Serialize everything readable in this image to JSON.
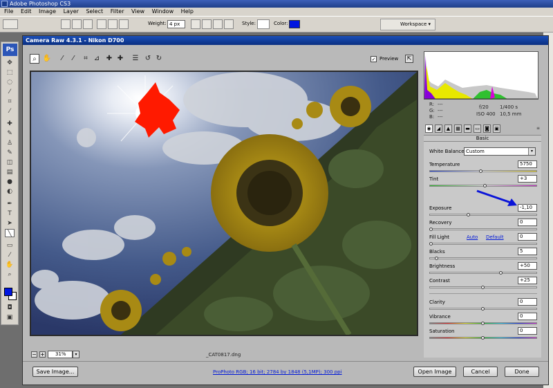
{
  "app": {
    "title": "Adobe Photoshop CS3",
    "menu": [
      "File",
      "Edit",
      "Image",
      "Layer",
      "Select",
      "Filter",
      "View",
      "Window",
      "Help"
    ]
  },
  "options_bar": {
    "weight_label": "Weight:",
    "weight_value": "4 px",
    "style_label": "Style:",
    "color_label": "Color:",
    "color_value": "#0016e0",
    "workspace_label": "Workspace"
  },
  "toolbox": {
    "logo": "Ps",
    "foreground_color": "#0016e0",
    "background_color": "#ffffff"
  },
  "dialog": {
    "title": "Camera Raw 4.3.1  -  Nikon D700",
    "preview_label": "Preview",
    "preview_checked": true,
    "zoom": "31%",
    "filename": "_CAT0817.dng",
    "workflow": "ProPhoto RGB; 16 bit; 2784 by 1848 (5,1MP); 300 ppi",
    "buttons": {
      "save": "Save Image...",
      "open": "Open Image",
      "cancel": "Cancel",
      "done": "Done"
    }
  },
  "readout": {
    "r_label": "R:",
    "r_value": "---",
    "g_label": "G:",
    "g_value": "---",
    "b_label": "B:",
    "b_value": "---",
    "aperture": "f/20",
    "shutter": "1/400 s",
    "iso": "ISO 400",
    "focal": "10,5 mm"
  },
  "panel": {
    "title": "Basic",
    "white_balance_label": "White Balance:",
    "white_balance_value": "Custom",
    "auto_label": "Auto",
    "default_label": "Default",
    "sliders": [
      {
        "name": "Temperature",
        "value": "5750",
        "pos": 0.48,
        "track": "temp"
      },
      {
        "name": "Tint",
        "value": "+3",
        "pos": 0.52,
        "track": "tint"
      },
      {
        "name": "Exposure",
        "value": "-1,10",
        "pos": 0.36,
        "track": "plain"
      },
      {
        "name": "Recovery",
        "value": "0",
        "pos": 0.0,
        "track": "plain"
      },
      {
        "name": "Fill Light",
        "value": "0",
        "pos": 0.0,
        "track": "plain"
      },
      {
        "name": "Blacks",
        "value": "5",
        "pos": 0.05,
        "track": "plain"
      },
      {
        "name": "Brightness",
        "value": "+50",
        "pos": 0.67,
        "track": "plain"
      },
      {
        "name": "Contrast",
        "value": "+25",
        "pos": 0.5,
        "track": "plain"
      },
      {
        "name": "Clarity",
        "value": "0",
        "pos": 0.5,
        "track": "plain"
      },
      {
        "name": "Vibrance",
        "value": "0",
        "pos": 0.5,
        "track": "sat"
      },
      {
        "name": "Saturation",
        "value": "0",
        "pos": 0.5,
        "track": "sat"
      }
    ]
  }
}
